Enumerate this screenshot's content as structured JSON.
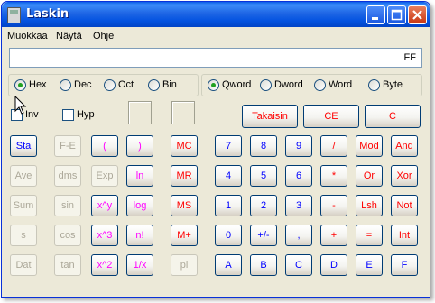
{
  "window": {
    "title": "Laskin"
  },
  "menu": [
    "Muokkaa",
    "Näytä",
    "Ohje"
  ],
  "display": {
    "value": "FF"
  },
  "base_options": [
    {
      "label": "Hex",
      "checked": true
    },
    {
      "label": "Dec",
      "checked": false
    },
    {
      "label": "Oct",
      "checked": false
    },
    {
      "label": "Bin",
      "checked": false
    }
  ],
  "word_options": [
    {
      "label": "Qword",
      "checked": true
    },
    {
      "label": "Dword",
      "checked": false
    },
    {
      "label": "Word",
      "checked": false
    },
    {
      "label": "Byte",
      "checked": false
    }
  ],
  "checkboxes": [
    {
      "label": "Inv",
      "checked": false
    },
    {
      "label": "Hyp",
      "checked": false
    }
  ],
  "edit_buttons": {
    "backspace": "Takaisin",
    "ce": "CE",
    "c": "C"
  },
  "buttons": {
    "sta": "Sta",
    "ave": "Ave",
    "sum": "Sum",
    "s": "s",
    "dat": "Dat",
    "fe": "F-E",
    "dms": "dms",
    "sin": "sin",
    "cos": "cos",
    "tan": "tan",
    "lparen": "(",
    "exp": "Exp",
    "xy": "x^y",
    "x3": "x^3",
    "x2": "x^2",
    "rparen": ")",
    "ln": "ln",
    "log": "log",
    "nfact": "n!",
    "recip": "1/x",
    "mc": "MC",
    "mr": "MR",
    "ms": "MS",
    "mplus": "M+",
    "pi": "pi",
    "d7": "7",
    "d8": "8",
    "d9": "9",
    "div": "/",
    "mod": "Mod",
    "and": "And",
    "d4": "4",
    "d5": "5",
    "d6": "6",
    "mul": "*",
    "or": "Or",
    "xor": "Xor",
    "d1": "1",
    "d2": "2",
    "d3": "3",
    "sub": "-",
    "lsh": "Lsh",
    "not": "Not",
    "d0": "0",
    "neg": "+/-",
    "dot": ",",
    "add": "+",
    "eq": "=",
    "int": "Int",
    "a": "A",
    "b": "B",
    "c": "C",
    "d": "D",
    "e": "E",
    "f": "F"
  },
  "colors": {
    "title_bar": "#0453e0",
    "blue_text": "#0000ff",
    "red_text": "#ff0000",
    "purple_text": "#ff00ff"
  }
}
